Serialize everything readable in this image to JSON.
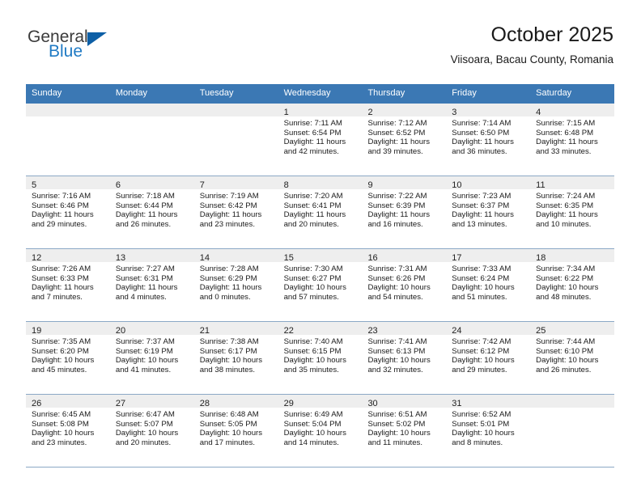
{
  "brand": {
    "name_top": "General",
    "name_bottom": "Blue",
    "accent_color": "#0d5fa6",
    "blue_text_color": "#1f7ac4"
  },
  "header": {
    "title": "October 2025",
    "location": "Viisoara, Bacau County, Romania"
  },
  "theme": {
    "header_row_bg": "#3b78b4",
    "day_band_bg": "#eeeeee",
    "grid_line": "#8ba8c6"
  },
  "weekdays": [
    "Sunday",
    "Monday",
    "Tuesday",
    "Wednesday",
    "Thursday",
    "Friday",
    "Saturday"
  ],
  "weeks": [
    [
      {
        "day": "",
        "lines": []
      },
      {
        "day": "",
        "lines": []
      },
      {
        "day": "",
        "lines": []
      },
      {
        "day": "1",
        "lines": [
          "Sunrise: 7:11 AM",
          "Sunset: 6:54 PM",
          "Daylight: 11 hours",
          "and 42 minutes."
        ]
      },
      {
        "day": "2",
        "lines": [
          "Sunrise: 7:12 AM",
          "Sunset: 6:52 PM",
          "Daylight: 11 hours",
          "and 39 minutes."
        ]
      },
      {
        "day": "3",
        "lines": [
          "Sunrise: 7:14 AM",
          "Sunset: 6:50 PM",
          "Daylight: 11 hours",
          "and 36 minutes."
        ]
      },
      {
        "day": "4",
        "lines": [
          "Sunrise: 7:15 AM",
          "Sunset: 6:48 PM",
          "Daylight: 11 hours",
          "and 33 minutes."
        ]
      }
    ],
    [
      {
        "day": "5",
        "lines": [
          "Sunrise: 7:16 AM",
          "Sunset: 6:46 PM",
          "Daylight: 11 hours",
          "and 29 minutes."
        ]
      },
      {
        "day": "6",
        "lines": [
          "Sunrise: 7:18 AM",
          "Sunset: 6:44 PM",
          "Daylight: 11 hours",
          "and 26 minutes."
        ]
      },
      {
        "day": "7",
        "lines": [
          "Sunrise: 7:19 AM",
          "Sunset: 6:42 PM",
          "Daylight: 11 hours",
          "and 23 minutes."
        ]
      },
      {
        "day": "8",
        "lines": [
          "Sunrise: 7:20 AM",
          "Sunset: 6:41 PM",
          "Daylight: 11 hours",
          "and 20 minutes."
        ]
      },
      {
        "day": "9",
        "lines": [
          "Sunrise: 7:22 AM",
          "Sunset: 6:39 PM",
          "Daylight: 11 hours",
          "and 16 minutes."
        ]
      },
      {
        "day": "10",
        "lines": [
          "Sunrise: 7:23 AM",
          "Sunset: 6:37 PM",
          "Daylight: 11 hours",
          "and 13 minutes."
        ]
      },
      {
        "day": "11",
        "lines": [
          "Sunrise: 7:24 AM",
          "Sunset: 6:35 PM",
          "Daylight: 11 hours",
          "and 10 minutes."
        ]
      }
    ],
    [
      {
        "day": "12",
        "lines": [
          "Sunrise: 7:26 AM",
          "Sunset: 6:33 PM",
          "Daylight: 11 hours",
          "and 7 minutes."
        ]
      },
      {
        "day": "13",
        "lines": [
          "Sunrise: 7:27 AM",
          "Sunset: 6:31 PM",
          "Daylight: 11 hours",
          "and 4 minutes."
        ]
      },
      {
        "day": "14",
        "lines": [
          "Sunrise: 7:28 AM",
          "Sunset: 6:29 PM",
          "Daylight: 11 hours",
          "and 0 minutes."
        ]
      },
      {
        "day": "15",
        "lines": [
          "Sunrise: 7:30 AM",
          "Sunset: 6:27 PM",
          "Daylight: 10 hours",
          "and 57 minutes."
        ]
      },
      {
        "day": "16",
        "lines": [
          "Sunrise: 7:31 AM",
          "Sunset: 6:26 PM",
          "Daylight: 10 hours",
          "and 54 minutes."
        ]
      },
      {
        "day": "17",
        "lines": [
          "Sunrise: 7:33 AM",
          "Sunset: 6:24 PM",
          "Daylight: 10 hours",
          "and 51 minutes."
        ]
      },
      {
        "day": "18",
        "lines": [
          "Sunrise: 7:34 AM",
          "Sunset: 6:22 PM",
          "Daylight: 10 hours",
          "and 48 minutes."
        ]
      }
    ],
    [
      {
        "day": "19",
        "lines": [
          "Sunrise: 7:35 AM",
          "Sunset: 6:20 PM",
          "Daylight: 10 hours",
          "and 45 minutes."
        ]
      },
      {
        "day": "20",
        "lines": [
          "Sunrise: 7:37 AM",
          "Sunset: 6:19 PM",
          "Daylight: 10 hours",
          "and 41 minutes."
        ]
      },
      {
        "day": "21",
        "lines": [
          "Sunrise: 7:38 AM",
          "Sunset: 6:17 PM",
          "Daylight: 10 hours",
          "and 38 minutes."
        ]
      },
      {
        "day": "22",
        "lines": [
          "Sunrise: 7:40 AM",
          "Sunset: 6:15 PM",
          "Daylight: 10 hours",
          "and 35 minutes."
        ]
      },
      {
        "day": "23",
        "lines": [
          "Sunrise: 7:41 AM",
          "Sunset: 6:13 PM",
          "Daylight: 10 hours",
          "and 32 minutes."
        ]
      },
      {
        "day": "24",
        "lines": [
          "Sunrise: 7:42 AM",
          "Sunset: 6:12 PM",
          "Daylight: 10 hours",
          "and 29 minutes."
        ]
      },
      {
        "day": "25",
        "lines": [
          "Sunrise: 7:44 AM",
          "Sunset: 6:10 PM",
          "Daylight: 10 hours",
          "and 26 minutes."
        ]
      }
    ],
    [
      {
        "day": "26",
        "lines": [
          "Sunrise: 6:45 AM",
          "Sunset: 5:08 PM",
          "Daylight: 10 hours",
          "and 23 minutes."
        ]
      },
      {
        "day": "27",
        "lines": [
          "Sunrise: 6:47 AM",
          "Sunset: 5:07 PM",
          "Daylight: 10 hours",
          "and 20 minutes."
        ]
      },
      {
        "day": "28",
        "lines": [
          "Sunrise: 6:48 AM",
          "Sunset: 5:05 PM",
          "Daylight: 10 hours",
          "and 17 minutes."
        ]
      },
      {
        "day": "29",
        "lines": [
          "Sunrise: 6:49 AM",
          "Sunset: 5:04 PM",
          "Daylight: 10 hours",
          "and 14 minutes."
        ]
      },
      {
        "day": "30",
        "lines": [
          "Sunrise: 6:51 AM",
          "Sunset: 5:02 PM",
          "Daylight: 10 hours",
          "and 11 minutes."
        ]
      },
      {
        "day": "31",
        "lines": [
          "Sunrise: 6:52 AM",
          "Sunset: 5:01 PM",
          "Daylight: 10 hours",
          "and 8 minutes."
        ]
      },
      {
        "day": "",
        "lines": []
      }
    ]
  ]
}
